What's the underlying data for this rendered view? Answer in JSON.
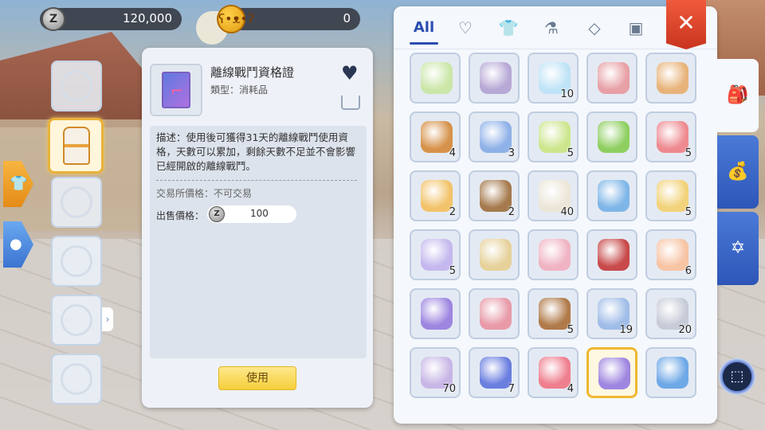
{
  "currency": {
    "zeny": "120,000",
    "gems": "0",
    "zeny_icon": "z-coin-icon",
    "gem_icon": "bear-coin-icon"
  },
  "equipment_slots": [
    {
      "icon": "accessory-ring-icon"
    },
    {
      "icon": "costume-outfit-icon",
      "active": true
    },
    {
      "icon": "cape-icon"
    },
    {
      "icon": "boots-icon"
    },
    {
      "icon": "ring-icon"
    },
    {
      "icon": "ring-icon"
    }
  ],
  "detail": {
    "item_name": "離線戰鬥資格證",
    "type_text": "類型：消耗品",
    "description": "描述：使用後可獲得31天的離線戰鬥使用資格，天數可以累加，剩餘天數不足並不會影響已經開啟的離線戰鬥。",
    "trade_text": "交易所價格：不可交易",
    "sell_label": "出售價格：",
    "sell_price": "100",
    "use_label": "使用",
    "coin_glyph": "Z"
  },
  "inventory": {
    "tabs": [
      {
        "label": "All",
        "icon": "all-tab"
      },
      {
        "label": "♡",
        "icon": "heart-icon"
      },
      {
        "label": "👕",
        "icon": "shirt-icon"
      },
      {
        "label": "⚗",
        "icon": "potion-icon"
      },
      {
        "label": "◇",
        "icon": "gem-icon"
      },
      {
        "label": "▣",
        "icon": "card-icon"
      }
    ],
    "close_label": "✕",
    "items": [
      {
        "name": "green-crystal-item",
        "color": "#cbe6a8",
        "count": ""
      },
      {
        "name": "purple-mortar-item",
        "color": "#b7a8d6",
        "count": ""
      },
      {
        "name": "blue-spark-item",
        "color": "#bfe3f7",
        "count": "10"
      },
      {
        "name": "red-staff-item",
        "color": "#e7a0a6",
        "count": ""
      },
      {
        "name": "bento-box-item",
        "color": "#e8b37a",
        "count": ""
      },
      {
        "name": "food-tray-item",
        "color": "#d6924a",
        "count": "4"
      },
      {
        "name": "blue-firework-item",
        "color": "#8eb1e8",
        "count": "3"
      },
      {
        "name": "green-potion-item",
        "color": "#cde68e",
        "count": "5"
      },
      {
        "name": "green-mortar-item",
        "color": "#8fcf62",
        "count": ""
      },
      {
        "name": "red-potion-item",
        "color": "#ee8a90",
        "count": "5"
      },
      {
        "name": "orange-wand-item",
        "color": "#f2c36a",
        "count": "2"
      },
      {
        "name": "wood-log-item",
        "color": "#a57a4e",
        "count": "2"
      },
      {
        "name": "white-vase-item",
        "color": "#ece6d8",
        "count": "40"
      },
      {
        "name": "blue-orb-item",
        "color": "#7fb6e8",
        "count": ""
      },
      {
        "name": "gold-ticket-item",
        "color": "#f2d27a",
        "count": "5"
      },
      {
        "name": "rainbow-bottle-item",
        "color": "#c5b8ee",
        "count": "5"
      },
      {
        "name": "gold-flute-item",
        "color": "#e6d19a",
        "count": ""
      },
      {
        "name": "pink-basket-item",
        "color": "#f0b3c3",
        "count": ""
      },
      {
        "name": "red-hat-item",
        "color": "#c84a4a",
        "count": ""
      },
      {
        "name": "peach-potion-item",
        "color": "#f7c4a4",
        "count": "6"
      },
      {
        "name": "battle-card-item",
        "color": "#9e86e0",
        "count": ""
      },
      {
        "name": "gift-box-item",
        "color": "#e89aa8",
        "count": ""
      },
      {
        "name": "leaf-pile-item",
        "color": "#b07a4a",
        "count": "5"
      },
      {
        "name": "blue-scroll-item",
        "color": "#a0bde8",
        "count": "19"
      },
      {
        "name": "feather-item",
        "color": "#c7cbd8",
        "count": "20"
      },
      {
        "name": "purple-vase-item",
        "color": "#c8b6e6",
        "count": "70"
      },
      {
        "name": "blue-chain-item",
        "color": "#6a7ee0",
        "count": "7"
      },
      {
        "name": "red-folder-item",
        "color": "#ef7f8e",
        "count": "4"
      },
      {
        "name": "battle-card-selected-item",
        "color": "#9e86e0",
        "count": "",
        "selected": true
      },
      {
        "name": "blue-gift-item",
        "color": "#6ea8e6",
        "count": ""
      }
    ]
  },
  "side_tabs": {
    "bag": "🎒",
    "zeny_bag": "💰",
    "cards": "✡"
  },
  "corner_button": "⬚"
}
